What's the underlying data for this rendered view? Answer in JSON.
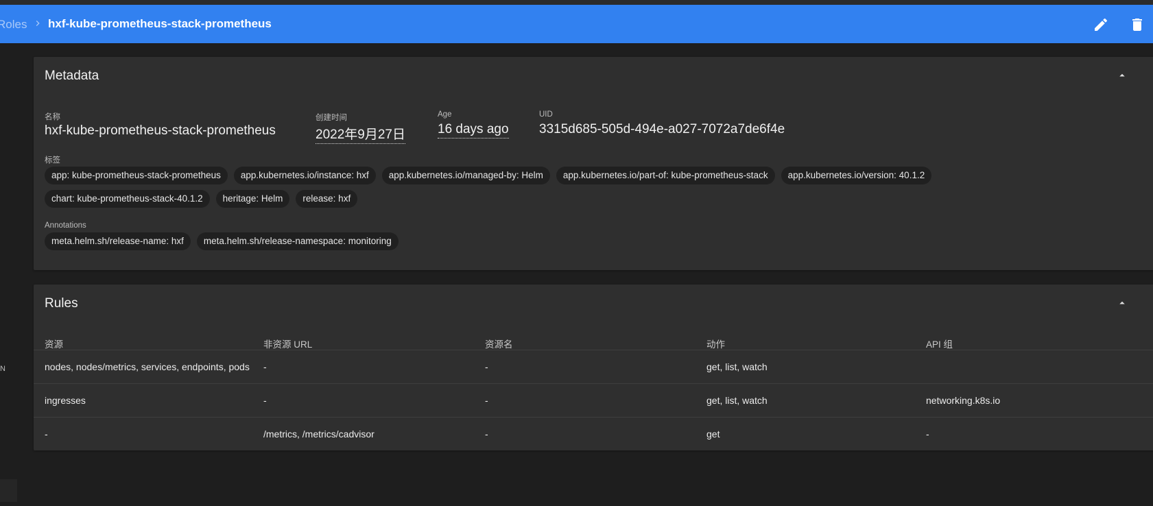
{
  "breadcrumb": {
    "parent": "Roles",
    "title": "hxf-kube-prometheus-stack-prometheus"
  },
  "toolbar": {
    "edit_icon": "edit-icon",
    "delete_icon": "delete-icon"
  },
  "sidebar": {
    "fragment": "N"
  },
  "metadata": {
    "title": "Metadata",
    "name_label": "名称",
    "name_value": "hxf-kube-prometheus-stack-prometheus",
    "created_label": "创建时间",
    "created_value": "2022年9月27日",
    "age_label": "Age",
    "age_value": "16 days ago",
    "uid_label": "UID",
    "uid_value": "3315d685-505d-494e-a027-7072a7de6f4e",
    "labels_label": "标签",
    "labels_row1": [
      "app: kube-prometheus-stack-prometheus",
      "app.kubernetes.io/instance: hxf",
      "app.kubernetes.io/managed-by: Helm",
      "app.kubernetes.io/part-of: kube-prometheus-stack",
      "app.kubernetes.io/version: 40.1.2"
    ],
    "labels_row2": [
      "chart: kube-prometheus-stack-40.1.2",
      "heritage: Helm",
      "release: hxf"
    ],
    "annotations_label": "Annotations",
    "annotations": [
      "meta.helm.sh/release-name: hxf",
      "meta.helm.sh/release-namespace: monitoring"
    ]
  },
  "rules": {
    "title": "Rules",
    "columns": [
      "资源",
      "非资源 URL",
      "资源名",
      "动作",
      "API 组"
    ],
    "rows": [
      [
        "nodes, nodes/metrics, services, endpoints, pods",
        "-",
        "-",
        "get, list, watch",
        ""
      ],
      [
        "ingresses",
        "-",
        "-",
        "get, list, watch",
        "networking.k8s.io"
      ],
      [
        "-",
        "/metrics, /metrics/cadvisor",
        "-",
        "get",
        "-"
      ]
    ]
  },
  "colors": {
    "toolbar": "#3281f0",
    "background": "#1e1e1e",
    "card": "#2f2f2f",
    "chip": "#202020"
  }
}
